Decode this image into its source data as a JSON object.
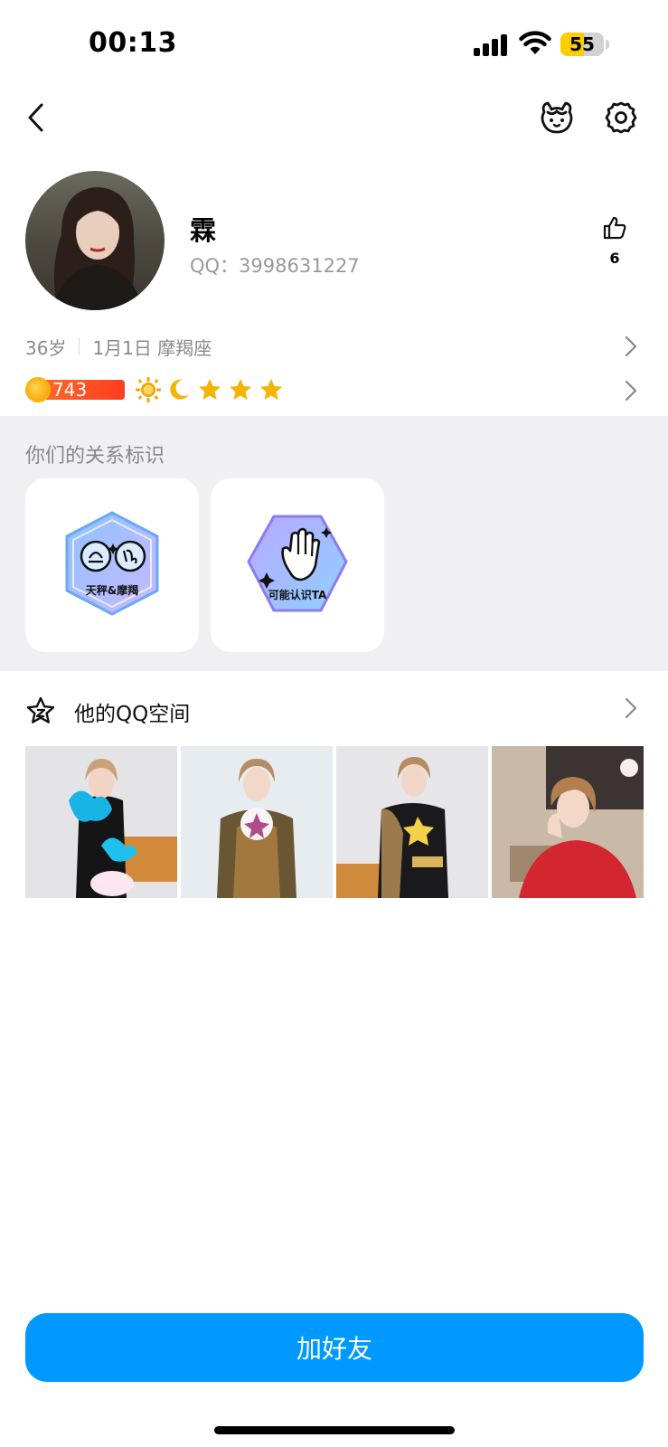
{
  "status_bar": {
    "time": "00:13",
    "battery_level": "55",
    "battery_percent": 55,
    "battery_color": "#ffcc00"
  },
  "nav": {
    "back_icon": "chevron-left-icon",
    "pet_icon": "pet-face-icon",
    "settings_icon": "gear-icon"
  },
  "profile": {
    "nickname": "霖",
    "qq_label": "QQ：3998631227",
    "like_count": "6",
    "age": "36岁",
    "birthday_sign": "1月1日 摩羯座",
    "vip_level": "743",
    "level_icons": [
      "sun-icon",
      "moon-icon",
      "star-icon",
      "star-icon",
      "star-icon"
    ]
  },
  "relation": {
    "title": "你们的关系标识",
    "badges": [
      {
        "label": "天秤&摩羯",
        "icon": "zodiac-badge-icon"
      },
      {
        "label": "可能认识TA",
        "icon": "hand-wave-badge-icon"
      }
    ]
  },
  "qzone": {
    "title": "他的QQ空间",
    "icon": "star-face-icon",
    "photo_count": 4
  },
  "actions": {
    "add_friend": "加好友",
    "primary_color": "#0099ff"
  }
}
